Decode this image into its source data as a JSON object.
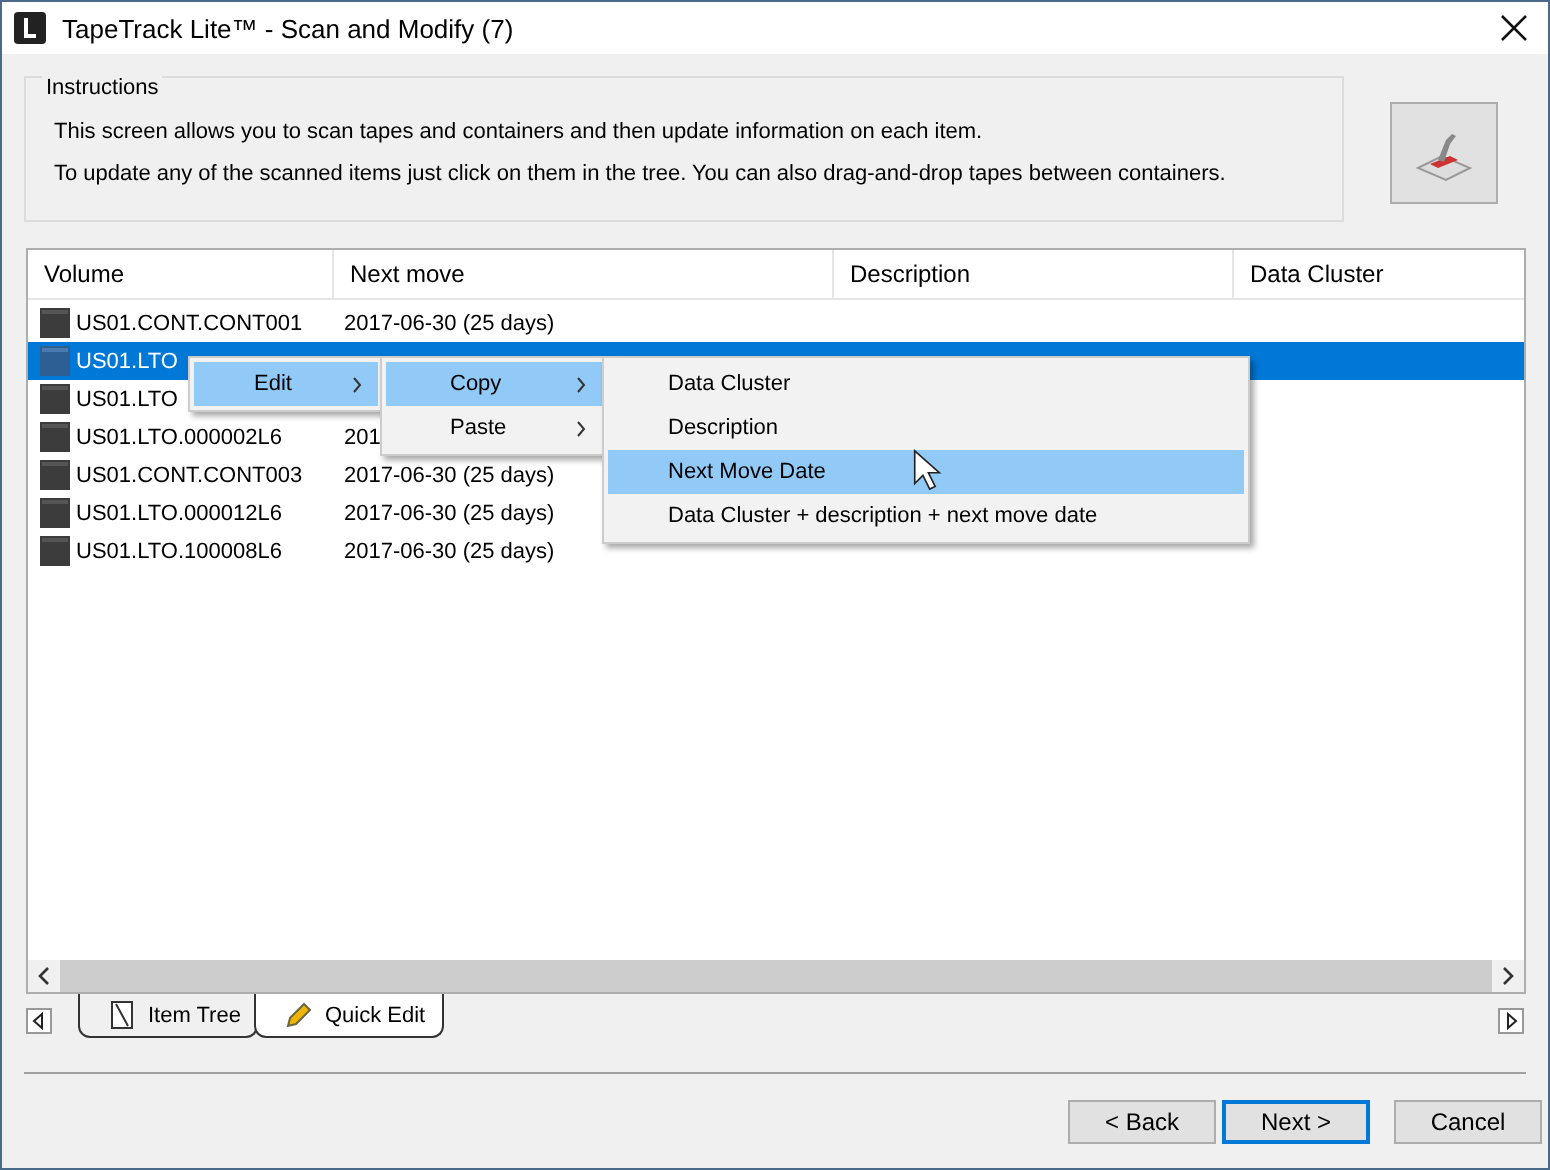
{
  "window": {
    "title": "TapeTrack Lite™ - Scan and Modify (7)"
  },
  "instructions": {
    "legend": "Instructions",
    "lines": [
      "This screen allows you to scan tapes and containers and then update information on each item.",
      "To update any of the scanned items just click on them in the tree. You can also drag-and-drop tapes between containers."
    ]
  },
  "table": {
    "columns": [
      "Volume",
      "Next move",
      "Description",
      "Data Cluster"
    ],
    "rows": [
      {
        "volume": "US01.CONT.CONT001",
        "next_move": "2017-06-30 (25 days)",
        "selected": false
      },
      {
        "volume": "US01.LTO",
        "selected": true
      },
      {
        "volume": "US01.LTO",
        "selected": false
      },
      {
        "volume": "US01.LTO.000002L6",
        "next_move": "201",
        "selected": false
      },
      {
        "volume": "US01.CONT.CONT003",
        "next_move": "2017-06-30 (25 days)",
        "selected": false
      },
      {
        "volume": "US01.LTO.000012L6",
        "next_move": "2017-06-30 (25 days)",
        "selected": false
      },
      {
        "volume": "US01.LTO.100008L6",
        "next_move": "2017-06-30 (25 days)",
        "selected": false
      }
    ]
  },
  "menus": [
    {
      "items": [
        {
          "label": "Edit",
          "selected": true,
          "submenu": true
        }
      ]
    },
    {
      "items": [
        {
          "label": "Copy",
          "selected": true,
          "submenu": true
        },
        {
          "label": "Paste",
          "selected": false,
          "submenu": true
        }
      ]
    },
    {
      "items": [
        {
          "label": "Data Cluster",
          "selected": false,
          "submenu": false
        },
        {
          "label": "Description",
          "selected": false,
          "submenu": false
        },
        {
          "label": "Next Move Date",
          "selected": true,
          "submenu": false
        },
        {
          "label": "Data Cluster + description + next move date",
          "selected": false,
          "submenu": false
        }
      ]
    }
  ],
  "tabs": [
    {
      "label": "Item Tree",
      "selected": false
    },
    {
      "label": "Quick Edit",
      "selected": true
    }
  ],
  "buttons": [
    {
      "label": "< Back",
      "default": false
    },
    {
      "label": "Next >",
      "default": true
    },
    {
      "label": "Cancel",
      "default": false
    }
  ]
}
